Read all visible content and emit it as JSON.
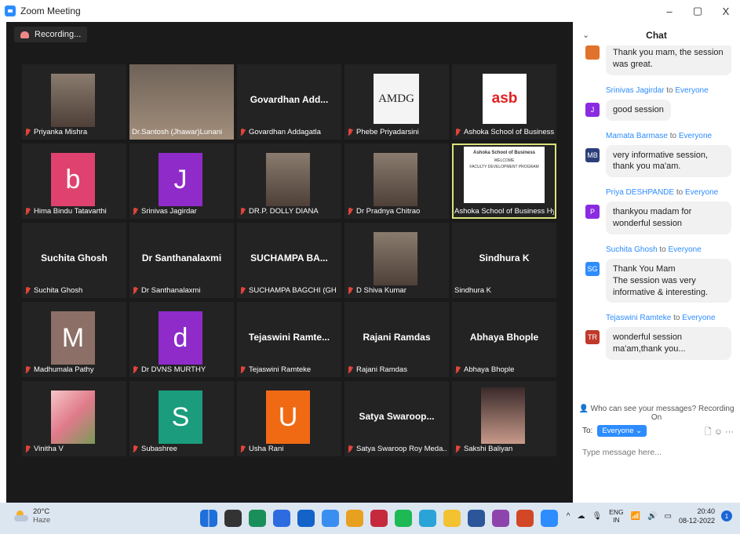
{
  "window": {
    "title": "Zoom Meeting",
    "minimize": "–",
    "restore": "▢",
    "close": "X"
  },
  "meeting": {
    "recording_label": "Recording...",
    "tiles": [
      {
        "label": "Priyanka Mishra",
        "center": "",
        "muted": true
      },
      {
        "label": "Dr.Santosh (Jhawar)Lunani",
        "center": "",
        "muted": false
      },
      {
        "label": "Govardhan Addagatla",
        "center": "Govardhan Add...",
        "muted": true
      },
      {
        "label": "Phebe Priyadarsini",
        "center": "",
        "muted": true
      },
      {
        "label": "Ashoka School of Business ...",
        "center": "",
        "muted": true
      },
      {
        "label": "Hima Bindu Tatavarthi",
        "center": "",
        "muted": true,
        "initial": "b"
      },
      {
        "label": "Srinivas Jagirdar",
        "center": "",
        "muted": true,
        "initial": "J"
      },
      {
        "label": "DR.P. DOLLY DIANA",
        "center": "",
        "muted": true
      },
      {
        "label": "Dr Pradnya Chitrao",
        "center": "",
        "muted": true
      },
      {
        "label": "Ashoka School of Business Hy...",
        "center": "",
        "muted": false
      },
      {
        "label": "Suchita Ghosh",
        "center": "Suchita Ghosh",
        "muted": true
      },
      {
        "label": "Dr Santhanalaxmi",
        "center": "Dr Santhanalaxmi",
        "muted": true
      },
      {
        "label": "SUCHAMPA BAGCHI (GH R...",
        "center": "SUCHAMPA BA...",
        "muted": true
      },
      {
        "label": "D Shiva Kumar",
        "center": "",
        "muted": true
      },
      {
        "label": "Sindhura K",
        "center": "Sindhura K",
        "muted": false
      },
      {
        "label": "Madhumala Pathy",
        "center": "",
        "muted": true,
        "initial": "M"
      },
      {
        "label": "Dr DVNS MURTHY",
        "center": "",
        "muted": true,
        "initial": "d"
      },
      {
        "label": "Tejaswini Ramteke",
        "center": "Tejaswini  Ramte...",
        "muted": true
      },
      {
        "label": "Rajani Ramdas",
        "center": "Rajani Ramdas",
        "muted": true
      },
      {
        "label": "Abhaya Bhople",
        "center": "Abhaya Bhople",
        "muted": true
      },
      {
        "label": "Vinitha V",
        "center": "",
        "muted": true
      },
      {
        "label": "Subashree",
        "center": "",
        "muted": true,
        "initial": "S"
      },
      {
        "label": "Usha Rani",
        "center": "",
        "muted": true,
        "initial": "U"
      },
      {
        "label": "Satya Swaroop Roy Meda...",
        "center": "Satya  Swaroop...",
        "muted": true
      },
      {
        "label": "Sakshi Baliyan",
        "center": "",
        "muted": true
      }
    ],
    "asb_logo_text": "asb",
    "amdg_logo_text": "AMDG",
    "slide_title": "Ashoka School of Business",
    "slide_welcome": "WELCOME",
    "slide_fdp": "FACULTY DEVELOPMENT PROGRAM"
  },
  "chat": {
    "title": "Chat",
    "collapse_icon": "⌄",
    "messages": [
      {
        "sender": "",
        "to": "",
        "avatar": "",
        "text": "Thank you mam, the session was great.",
        "color": "#e0722c"
      },
      {
        "sender": "Srinivas Jagirdar",
        "to": "to",
        "recipient": "Everyone",
        "avatar": "J",
        "text": "good session",
        "color": "#8a2be2"
      },
      {
        "sender": "Mamata Barmase",
        "to": "to",
        "recipient": "Everyone",
        "avatar": "MB",
        "text": "very informative session, thank you ma'am.",
        "color": "#2c3e7a"
      },
      {
        "sender": "Priya DESHPANDE",
        "to": "to",
        "recipient": "Everyone",
        "avatar": "P",
        "text": "thankyou madam for wonderful session",
        "color": "#8a2be2"
      },
      {
        "sender": "Suchita Ghosh",
        "to": "to",
        "recipient": "Everyone",
        "avatar": "SG",
        "text": "Thank You Mam\nThe session was very informative & interesting.",
        "color": "#2d8cff"
      },
      {
        "sender": "Tejaswini Ramteke",
        "to": "to",
        "recipient": "Everyone",
        "avatar": "TR",
        "text": "wonderful session ma'am,thank you...",
        "color": "#c0392b"
      }
    ],
    "who_can_see": "Who can see your messages? Recording On",
    "to_label": "To:",
    "to_value": "Everyone ⌄",
    "input_placeholder": "Type message here...",
    "file_icon": "🗋",
    "emoji_icon": "☺",
    "more_icon": "···"
  },
  "taskbar": {
    "temperature": "20°C",
    "condition": "Haze",
    "lang_top": "ENG",
    "lang_bottom": "IN",
    "time": "20:40",
    "date": "08-12-2022",
    "notif_count": "1",
    "app_colors": [
      "#1e6fd9",
      "#333",
      "#1b8f5a",
      "#2d6be0",
      "#1463c9",
      "#3a8ef0",
      "#e8a020",
      "#c42a3c",
      "#1db954",
      "#2aa4d6",
      "#f2c230",
      "#2b579a",
      "#8e44ad",
      "#d24726",
      "#2d8cff"
    ]
  }
}
